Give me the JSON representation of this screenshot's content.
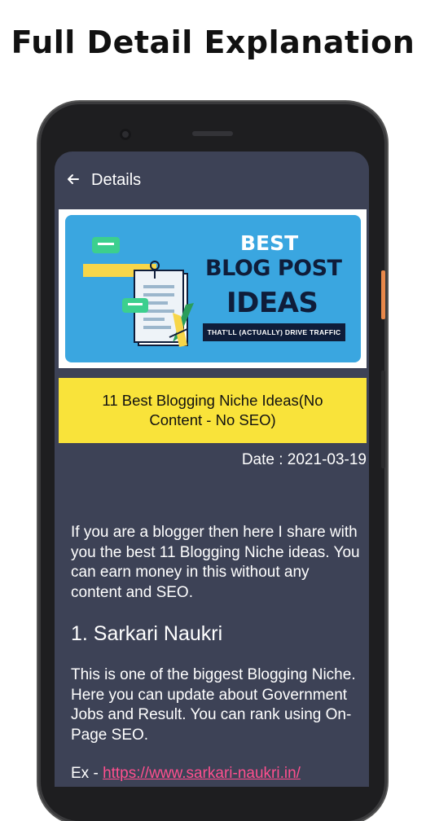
{
  "promo": {
    "heading": "Full Detail Explanation"
  },
  "colors": {
    "screen_bg": "#3d4256",
    "title_box": "#f9e33a",
    "link": "#ff4f8e",
    "banner_bg": "#3aa6e0",
    "side_button": "#e8884a"
  },
  "appbar": {
    "back_icon": "arrow-left-icon",
    "title": "Details"
  },
  "banner": {
    "line1": "BEST",
    "line2": "BLOG POST",
    "line3": "IDEAS",
    "tagline": "THAT'LL (ACTUALLY) DRIVE TRAFFIC"
  },
  "post": {
    "title": "11 Best Blogging Niche Ideas(No Content - No SEO)",
    "date": "Date : 2021-03-19",
    "intro": "If you are a blogger then here I share with you the best 11 Blogging Niche ideas. You can earn money in this without any content and SEO.",
    "section_heading": "1. Sarkari Naukri",
    "section_text": "This is one of the biggest Blogging Niche. Here you can update about Government Jobs and Result. You can rank using On-Page SEO.",
    "example_prefix": "Ex - ",
    "example_link": "https://www.sarkari-naukri.in/"
  }
}
